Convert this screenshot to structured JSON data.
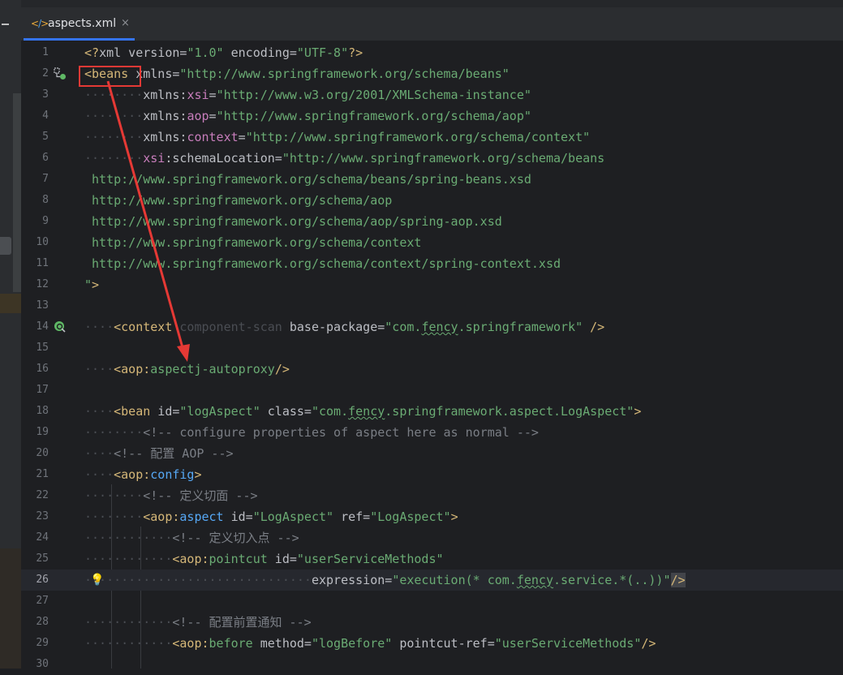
{
  "tab": {
    "filename": "aspects.xml",
    "close": "×"
  },
  "lines": [
    {
      "n": "1"
    },
    {
      "n": "2"
    },
    {
      "n": "3"
    },
    {
      "n": "4"
    },
    {
      "n": "5"
    },
    {
      "n": "6"
    },
    {
      "n": "7"
    },
    {
      "n": "8"
    },
    {
      "n": "9"
    },
    {
      "n": "10"
    },
    {
      "n": "11"
    },
    {
      "n": "12"
    },
    {
      "n": "13"
    },
    {
      "n": "14"
    },
    {
      "n": "15"
    },
    {
      "n": "16"
    },
    {
      "n": "17"
    },
    {
      "n": "18"
    },
    {
      "n": "19"
    },
    {
      "n": "20"
    },
    {
      "n": "21"
    },
    {
      "n": "22"
    },
    {
      "n": "23"
    },
    {
      "n": "24"
    },
    {
      "n": "25"
    },
    {
      "n": "26"
    },
    {
      "n": "27"
    },
    {
      "n": "28"
    },
    {
      "n": "29"
    },
    {
      "n": "30"
    }
  ],
  "code": {
    "l1_prolog_open": "<?",
    "l1_xml": "xml",
    "l1_version_attr": " version=",
    "l1_version_val": "\"1.0\"",
    "l1_encoding_attr": " encoding=",
    "l1_encoding_val": "\"UTF-8\"",
    "l1_prolog_close": "?>",
    "l2_tag": "<beans",
    "l2_attr": " xmlns=",
    "l2_val": "\"http://www.springframework.org/schema/beans\"",
    "l3_attr": "xmlns:",
    "l3_ns": "xsi",
    "l3_eq": "=",
    "l3_val": "\"http://www.w3.org/2001/XMLSchema-instance\"",
    "l4_attr": "xmlns:",
    "l4_ns": "aop",
    "l4_eq": "=",
    "l4_val": "\"http://www.springframework.org/schema/aop\"",
    "l5_attr": "xmlns:",
    "l5_ns": "context",
    "l5_eq": "=",
    "l5_val": "\"http://www.springframework.org/schema/context\"",
    "l6_ns": "xsi",
    "l6_attr": ":schemaLocation=",
    "l6_val": "\"http://www.springframework.org/schema/beans",
    "l7": " http://www.springframework.org/schema/beans/spring-beans.xsd",
    "l8": " http://www.springframework.org/schema/aop",
    "l9": " http://www.springframework.org/schema/aop/spring-aop.xsd",
    "l10": " http://www.springframework.org/schema/context",
    "l11": " http://www.springframework.org/schema/context/spring-context.xsd",
    "l12_close": "\"",
    "l12_gt": ">",
    "l14_open": "<context",
    "l14_rest": " component-scan",
    "l14_attr": " base-package=",
    "l14_val_a": "\"com.",
    "l14_val_b": "fency",
    "l14_val_c": ".springframework\"",
    "l14_end": " />",
    "l16_open": "<aop",
    "l16_colon": ":",
    "l16_name": "aspectj-autoproxy",
    "l16_end": "/>",
    "l18_open": "<bean",
    "l18_id_attr": " id=",
    "l18_id_val": "\"logAspect\"",
    "l18_class_attr": " class=",
    "l18_class_a": "\"com.",
    "l18_class_b": "fency",
    "l18_class_c": ".springframework.aspect.LogAspect\"",
    "l18_end": ">",
    "l19": "<!-- configure properties of aspect here as normal -->",
    "l20": "<!-- 配置 AOP -->",
    "l21_open": "<aop",
    "l21_colon": ":",
    "l21_name": "config",
    "l21_end": ">",
    "l22": "<!-- 定义切面 -->",
    "l23_open": "<aop",
    "l23_colon": ":",
    "l23_name": "aspect",
    "l23_id_attr": " id=",
    "l23_id_val": "\"LogAspect\"",
    "l23_ref_attr": " ref=",
    "l23_ref_val": "\"LogAspect\"",
    "l23_end": ">",
    "l24": "<!-- 定义切入点 -->",
    "l25_open": "<aop",
    "l25_colon": ":",
    "l25_name": "pointcut",
    "l25_id_attr": " id=",
    "l25_id_val": "\"userServiceMethods\"",
    "l26_attr": "expression=",
    "l26_val_a": "\"execution(* com.",
    "l26_val_b": "fency",
    "l26_val_c": ".service.*(..))\"",
    "l26_end": "/>",
    "l28": "<!-- 配置前置通知 -->",
    "l29_open": "<aop",
    "l29_colon": ":",
    "l29_name": "before",
    "l29_method_attr": " method=",
    "l29_method_val": "\"logBefore\"",
    "l29_ref_attr": " pointcut-ref=",
    "l29_ref_val": "\"userServiceMethods\"",
    "l29_end": "/>"
  },
  "icons": {
    "bulb": "💡"
  },
  "colors": {
    "annotation": "#e53935",
    "accent": "#3574f0"
  }
}
